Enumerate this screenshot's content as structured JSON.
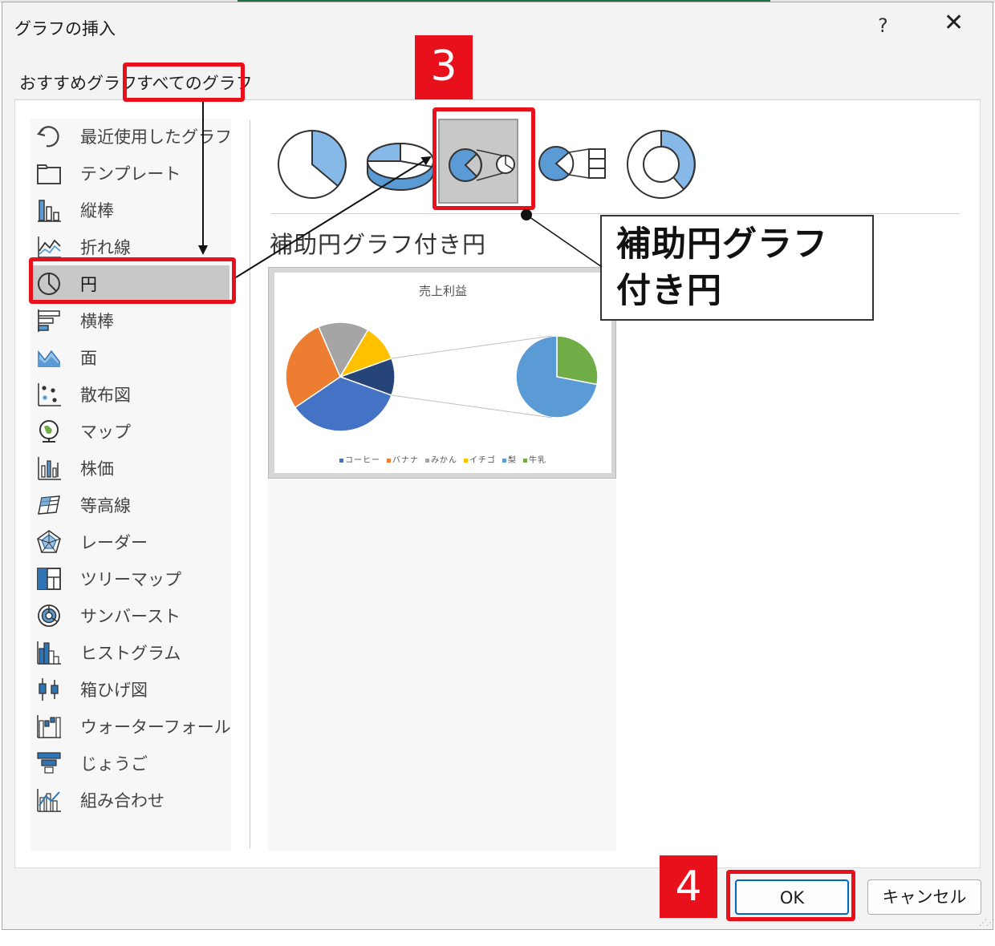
{
  "dialog": {
    "title": "グラフの挿入",
    "help_label": "?",
    "close_label": "✕"
  },
  "tabs": [
    {
      "label": "おすすめグラフ",
      "selected": false
    },
    {
      "label": "すべてのグラフ",
      "selected": true
    }
  ],
  "chart_types": [
    {
      "label": "最近使用したグラフ",
      "icon": "recent-icon"
    },
    {
      "label": "テンプレート",
      "icon": "folder-icon"
    },
    {
      "label": "縦棒",
      "icon": "column-chart-icon"
    },
    {
      "label": "折れ線",
      "icon": "line-chart-icon"
    },
    {
      "label": "円",
      "icon": "pie-chart-icon",
      "selected": true
    },
    {
      "label": "横棒",
      "icon": "bar-chart-icon"
    },
    {
      "label": "面",
      "icon": "area-chart-icon"
    },
    {
      "label": "散布図",
      "icon": "scatter-chart-icon"
    },
    {
      "label": "マップ",
      "icon": "map-globe-icon"
    },
    {
      "label": "株価",
      "icon": "stock-chart-icon"
    },
    {
      "label": "等高線",
      "icon": "surface-chart-icon"
    },
    {
      "label": "レーダー",
      "icon": "radar-chart-icon"
    },
    {
      "label": "ツリーマップ",
      "icon": "treemap-icon"
    },
    {
      "label": "サンバースト",
      "icon": "sunburst-icon"
    },
    {
      "label": "ヒストグラム",
      "icon": "histogram-icon"
    },
    {
      "label": "箱ひげ図",
      "icon": "box-whisker-icon"
    },
    {
      "label": "ウォーターフォール",
      "icon": "waterfall-icon"
    },
    {
      "label": "じょうご",
      "icon": "funnel-icon"
    },
    {
      "label": "組み合わせ",
      "icon": "combo-chart-icon"
    }
  ],
  "subtypes": [
    {
      "icon": "pie-2d-icon"
    },
    {
      "icon": "pie-3d-icon"
    },
    {
      "icon": "pie-of-pie-icon",
      "selected": true
    },
    {
      "icon": "bar-of-pie-icon"
    },
    {
      "icon": "doughnut-icon"
    }
  ],
  "selected_subtype_name": "補助円グラフ付き円",
  "callout": {
    "line1": "補助円グラフ",
    "line2": "付き円"
  },
  "steps": {
    "step3": "3",
    "step4": "4"
  },
  "buttons": {
    "ok": "OK",
    "cancel": "キャンセル"
  },
  "colors": {
    "highlight": "#e8101a",
    "accent": "#0067c0",
    "selected_bg": "#c8c8c8"
  },
  "chart_data": {
    "type": "pie",
    "subtype": "pie-of-pie",
    "title": "売上利益",
    "legend": [
      "コーヒー",
      "バナナ",
      "みかん",
      "イチゴ",
      "梨",
      "牛乳"
    ],
    "colors": [
      "#4472c4",
      "#ed7d31",
      "#a5a5a5",
      "#ffc000",
      "#5b9bd5",
      "#70ad47"
    ],
    "main_pie_fractions": {
      "コーヒー": 0.35,
      "バナナ": 0.28,
      "みかん": 0.15,
      "イチゴ": 0.11,
      "other": 0.11
    },
    "secondary_pie_fractions": {
      "梨": 0.72,
      "牛乳": 0.28
    }
  }
}
